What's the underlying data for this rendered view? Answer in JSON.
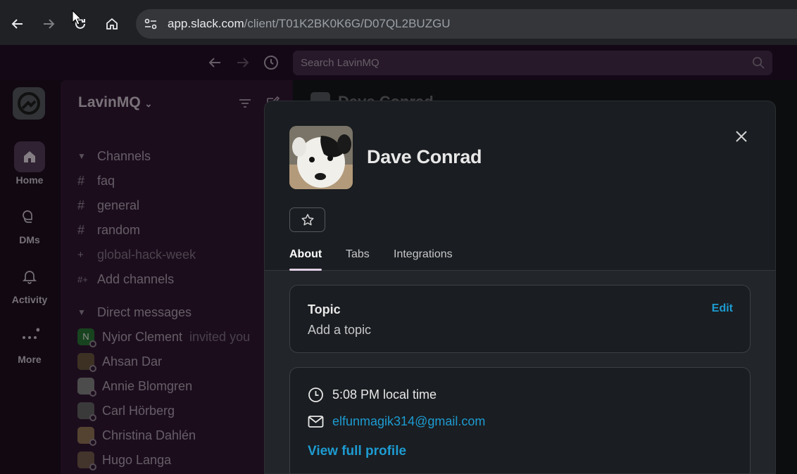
{
  "browser": {
    "url_domain": "app.slack.com",
    "url_path": "/client/T01K2BK0K6G/D07QL2BUZGU"
  },
  "search": {
    "placeholder": "Search LavinMQ"
  },
  "rail": {
    "items": [
      {
        "label": "Home",
        "icon": "home-icon"
      },
      {
        "label": "DMs",
        "icon": "dms-icon"
      },
      {
        "label": "Activity",
        "icon": "bell-icon"
      },
      {
        "label": "More",
        "icon": "more-icon"
      }
    ]
  },
  "sidebar": {
    "workspace": "LavinMQ",
    "channels_header": "Channels",
    "channels": [
      "faq",
      "general",
      "random",
      "global-hack-week"
    ],
    "add_channels": "Add channels",
    "dm_header": "Direct messages",
    "dms": [
      {
        "name": "Nyior Clement",
        "note": "invited you",
        "initial": "N",
        "color": "#2a7a3a"
      },
      {
        "name": "Ahsan Dar",
        "color": "#7a6a4a"
      },
      {
        "name": "Annie Blomgren",
        "color": "#8a8a8a"
      },
      {
        "name": "Carl Hörberg",
        "color": "#6a6a6a"
      },
      {
        "name": "Christina Dahlén",
        "color": "#9a7a5a"
      },
      {
        "name": "Hugo Langa",
        "color": "#7a6050"
      }
    ]
  },
  "main": {
    "header_name": "Dave Conrad"
  },
  "profile": {
    "name": "Dave Conrad",
    "tabs": [
      "About",
      "Tabs",
      "Integrations"
    ],
    "topic": {
      "title": "Topic",
      "placeholder": "Add a topic",
      "edit": "Edit"
    },
    "local_time": "5:08 PM local time",
    "email": "elfunmagik314@gmail.com",
    "view_full_profile": "View full profile"
  }
}
